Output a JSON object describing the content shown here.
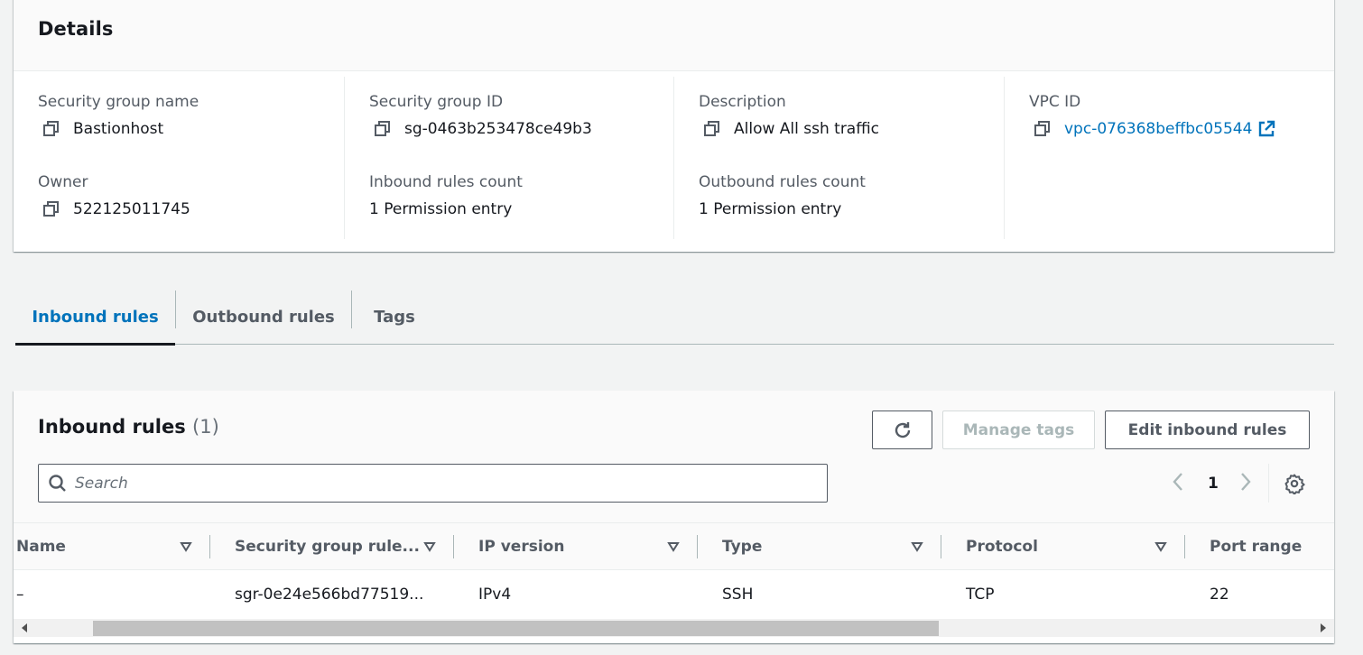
{
  "details": {
    "title": "Details",
    "security_group_name": {
      "label": "Security group name",
      "value": "Bastionhost"
    },
    "security_group_id": {
      "label": "Security group ID",
      "value": "sg-0463b253478ce49b3"
    },
    "description": {
      "label": "Description",
      "value": "Allow All ssh traffic"
    },
    "vpc_id": {
      "label": "VPC ID",
      "value": "vpc-076368beffbc05544"
    },
    "owner": {
      "label": "Owner",
      "value": "522125011745"
    },
    "inbound_rules_count": {
      "label": "Inbound rules count",
      "value": "1 Permission entry"
    },
    "outbound_rules_count": {
      "label": "Outbound rules count",
      "value": "1 Permission entry"
    }
  },
  "tabs": [
    {
      "label": "Inbound rules",
      "active": true
    },
    {
      "label": "Outbound rules",
      "active": false
    },
    {
      "label": "Tags",
      "active": false
    }
  ],
  "inbound_rules": {
    "title": "Inbound rules",
    "count": "(1)",
    "manage_tags_label": "Manage tags",
    "edit_label": "Edit inbound rules",
    "search_placeholder": "Search",
    "page": "1",
    "columns": [
      "Name",
      "Security group rule...",
      "IP version",
      "Type",
      "Protocol",
      "Port range"
    ],
    "rows": [
      [
        "–",
        "sgr-0e24e566bd77519...",
        "IPv4",
        "SSH",
        "TCP",
        "22"
      ]
    ]
  },
  "colors": {
    "link": "#0073bb",
    "text": "#16191f",
    "muted": "#545b64",
    "background": "#f2f3f3"
  }
}
